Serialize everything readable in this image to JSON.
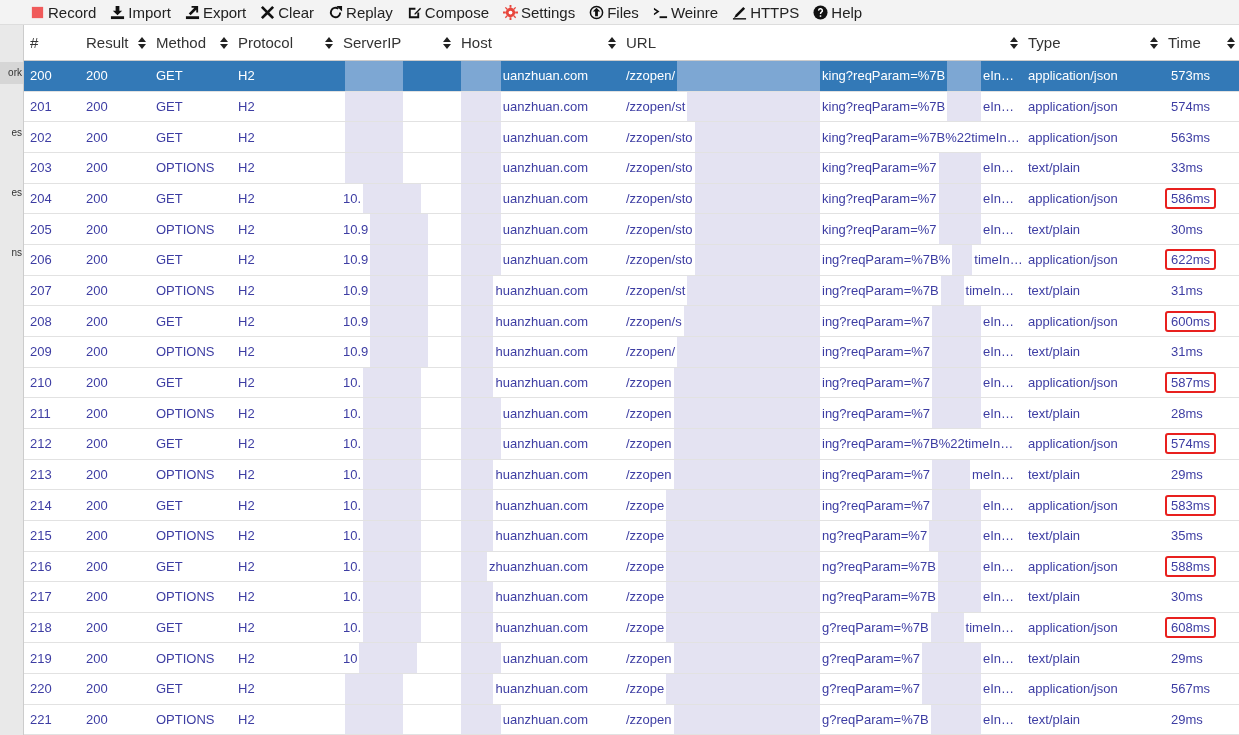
{
  "toolbar": [
    {
      "label": "Record",
      "kind": "record"
    },
    {
      "label": "Import",
      "kind": "import"
    },
    {
      "label": "Export",
      "kind": "export"
    },
    {
      "label": "Clear",
      "kind": "clear"
    },
    {
      "label": "Replay",
      "kind": "replay"
    },
    {
      "label": "Compose",
      "kind": "compose"
    },
    {
      "label": "Settings",
      "kind": "settings"
    },
    {
      "label": "Files",
      "kind": "files"
    },
    {
      "label": "Weinre",
      "kind": "weinre"
    },
    {
      "label": "HTTPS",
      "kind": "https"
    },
    {
      "label": "Help",
      "kind": "help"
    }
  ],
  "sidebar": {
    "items": [
      {
        "label": "ork",
        "selected": true
      },
      {
        "label": "es",
        "selected": false
      },
      {
        "label": "es",
        "selected": false
      },
      {
        "label": "ns",
        "selected": false
      }
    ]
  },
  "table": {
    "columns": [
      {
        "label": "#",
        "sortable": false
      },
      {
        "label": "Result",
        "sortable": true
      },
      {
        "label": "Method",
        "sortable": true
      },
      {
        "label": "Protocol",
        "sortable": true
      },
      {
        "label": "ServerIP",
        "sortable": true
      },
      {
        "label": "Host",
        "sortable": true
      },
      {
        "label": "URL",
        "sortable": true
      },
      {
        "label": "Type",
        "sortable": true
      },
      {
        "label": "Time",
        "sortable": true
      }
    ],
    "rows": [
      {
        "id": "200",
        "result": "200",
        "method": "GET",
        "protocol": "H2",
        "host": "uanzhuan.com",
        "url_parts": [
          "/zzopen/",
          "king?reqParam=%7B",
          "eIn…"
        ],
        "type": "application/json",
        "time": "573ms",
        "highlighted": false,
        "selected": true
      },
      {
        "id": "201",
        "result": "200",
        "method": "GET",
        "protocol": "H2",
        "host": "uanzhuan.com",
        "url_parts": [
          "/zzopen/st",
          "king?reqParam=%7B",
          "eIn…"
        ],
        "type": "application/json",
        "time": "574ms",
        "highlighted": false,
        "selected": false
      },
      {
        "id": "202",
        "result": "200",
        "method": "GET",
        "protocol": "H2",
        "host": "uanzhuan.com",
        "url_parts": [
          "/zzopen/sto",
          "king?reqParam=%7B%22timeIn…"
        ],
        "type": "application/json",
        "time": "563ms",
        "highlighted": false,
        "selected": false
      },
      {
        "id": "203",
        "result": "200",
        "method": "OPTIONS",
        "protocol": "H2",
        "host": "uanzhuan.com",
        "url_parts": [
          "/zzopen/sto",
          "king?reqParam=%7",
          "eIn…"
        ],
        "type": "text/plain",
        "time": "33ms",
        "highlighted": false,
        "selected": false
      },
      {
        "id": "204",
        "result": "200",
        "method": "GET",
        "protocol": "H2",
        "server_ip": "10.",
        "host": "uanzhuan.com",
        "url_parts": [
          "/zzopen/sto",
          "king?reqParam=%7",
          "eIn…"
        ],
        "type": "application/json",
        "time": "586ms",
        "highlighted": true,
        "selected": false
      },
      {
        "id": "205",
        "result": "200",
        "method": "OPTIONS",
        "protocol": "H2",
        "server_ip": "10.9",
        "host": "uanzhuan.com",
        "url_parts": [
          "/zzopen/sto",
          "king?reqParam=%7",
          "eIn…"
        ],
        "type": "text/plain",
        "time": "30ms",
        "highlighted": false,
        "selected": false
      },
      {
        "id": "206",
        "result": "200",
        "method": "GET",
        "protocol": "H2",
        "server_ip": "10.9",
        "host": "uanzhuan.com",
        "url_parts": [
          "/zzopen/sto",
          "ing?reqParam=%7B%",
          "timeIn…"
        ],
        "type": "application/json",
        "time": "622ms",
        "highlighted": true,
        "selected": false
      },
      {
        "id": "207",
        "result": "200",
        "method": "OPTIONS",
        "protocol": "H2",
        "server_ip": "10.9",
        "host": "huanzhuan.com",
        "url_parts": [
          "/zzopen/st",
          "ing?reqParam=%7B",
          "timeIn…"
        ],
        "type": "text/plain",
        "time": "31ms",
        "highlighted": false,
        "selected": false
      },
      {
        "id": "208",
        "result": "200",
        "method": "GET",
        "protocol": "H2",
        "server_ip": "10.9",
        "host": "huanzhuan.com",
        "url_parts": [
          "/zzopen/s",
          "ing?reqParam=%7",
          "eIn…"
        ],
        "type": "application/json",
        "time": "600ms",
        "highlighted": true,
        "selected": false
      },
      {
        "id": "209",
        "result": "200",
        "method": "OPTIONS",
        "protocol": "H2",
        "server_ip": "10.9",
        "host": "huanzhuan.com",
        "url_parts": [
          "/zzopen/",
          "ing?reqParam=%7",
          "eIn…"
        ],
        "type": "text/plain",
        "time": "31ms",
        "highlighted": false,
        "selected": false
      },
      {
        "id": "210",
        "result": "200",
        "method": "GET",
        "protocol": "H2",
        "server_ip": "10.",
        "host": "huanzhuan.com",
        "url_parts": [
          "/zzopen",
          "ing?reqParam=%7",
          "eIn…"
        ],
        "type": "application/json",
        "time": "587ms",
        "highlighted": true,
        "selected": false
      },
      {
        "id": "211",
        "result": "200",
        "method": "OPTIONS",
        "protocol": "H2",
        "server_ip": "10.",
        "host": "uanzhuan.com",
        "url_parts": [
          "/zzopen",
          "ing?reqParam=%7",
          "eIn…"
        ],
        "type": "text/plain",
        "time": "28ms",
        "highlighted": false,
        "selected": false
      },
      {
        "id": "212",
        "result": "200",
        "method": "GET",
        "protocol": "H2",
        "server_ip": "10.",
        "host": "uanzhuan.com",
        "url_parts": [
          "/zzopen",
          "ing?reqParam=%7B%22timeIn…"
        ],
        "type": "application/json",
        "time": "574ms",
        "highlighted": true,
        "selected": false
      },
      {
        "id": "213",
        "result": "200",
        "method": "OPTIONS",
        "protocol": "H2",
        "server_ip": "10.",
        "host": "huanzhuan.com",
        "url_parts": [
          "/zzopen",
          "ing?reqParam=%7",
          "meIn…"
        ],
        "type": "text/plain",
        "time": "29ms",
        "highlighted": false,
        "selected": false
      },
      {
        "id": "214",
        "result": "200",
        "method": "GET",
        "protocol": "H2",
        "server_ip": "10.",
        "host": "huanzhuan.com",
        "url_parts": [
          "/zzope",
          "ing?reqParam=%7",
          "eIn…"
        ],
        "type": "application/json",
        "time": "583ms",
        "highlighted": true,
        "selected": false
      },
      {
        "id": "215",
        "result": "200",
        "method": "OPTIONS",
        "protocol": "H2",
        "server_ip": "10.",
        "host": "huanzhuan.com",
        "url_parts": [
          "/zzope",
          "ng?reqParam=%7",
          "eIn…"
        ],
        "type": "text/plain",
        "time": "35ms",
        "highlighted": false,
        "selected": false
      },
      {
        "id": "216",
        "result": "200",
        "method": "GET",
        "protocol": "H2",
        "server_ip": "10.",
        "host": "zhuanzhuan.com",
        "url_parts": [
          "/zzope",
          "ng?reqParam=%7B",
          "eIn…"
        ],
        "type": "application/json",
        "time": "588ms",
        "highlighted": true,
        "selected": false
      },
      {
        "id": "217",
        "result": "200",
        "method": "OPTIONS",
        "protocol": "H2",
        "server_ip": "10.",
        "host": "huanzhuan.com",
        "url_parts": [
          "/zzope",
          "ng?reqParam=%7B",
          "eIn…"
        ],
        "type": "text/plain",
        "time": "30ms",
        "highlighted": false,
        "selected": false
      },
      {
        "id": "218",
        "result": "200",
        "method": "GET",
        "protocol": "H2",
        "server_ip": "10.",
        "host": "huanzhuan.com",
        "url_parts": [
          "/zzope",
          "g?reqParam=%7B",
          "timeIn…"
        ],
        "type": "application/json",
        "time": "608ms",
        "highlighted": true,
        "selected": false
      },
      {
        "id": "219",
        "result": "200",
        "method": "OPTIONS",
        "protocol": "H2",
        "server_ip": "10",
        "host": "uanzhuan.com",
        "url_parts": [
          "/zzopen",
          "g?reqParam=%7",
          "eIn…"
        ],
        "type": "text/plain",
        "time": "29ms",
        "highlighted": false,
        "selected": false
      },
      {
        "id": "220",
        "result": "200",
        "method": "GET",
        "protocol": "H2",
        "host": "huanzhuan.com",
        "url_parts": [
          "/zzope",
          "g?reqParam=%7",
          "eIn…"
        ],
        "type": "application/json",
        "time": "567ms",
        "highlighted": false,
        "selected": false
      },
      {
        "id": "221",
        "result": "200",
        "method": "OPTIONS",
        "protocol": "H2",
        "host": "uanzhuan.com",
        "url_parts": [
          "/zzopen",
          "g?reqParam=%7B",
          "eIn…"
        ],
        "type": "text/plain",
        "time": "29ms",
        "highlighted": false,
        "selected": false
      }
    ]
  }
}
